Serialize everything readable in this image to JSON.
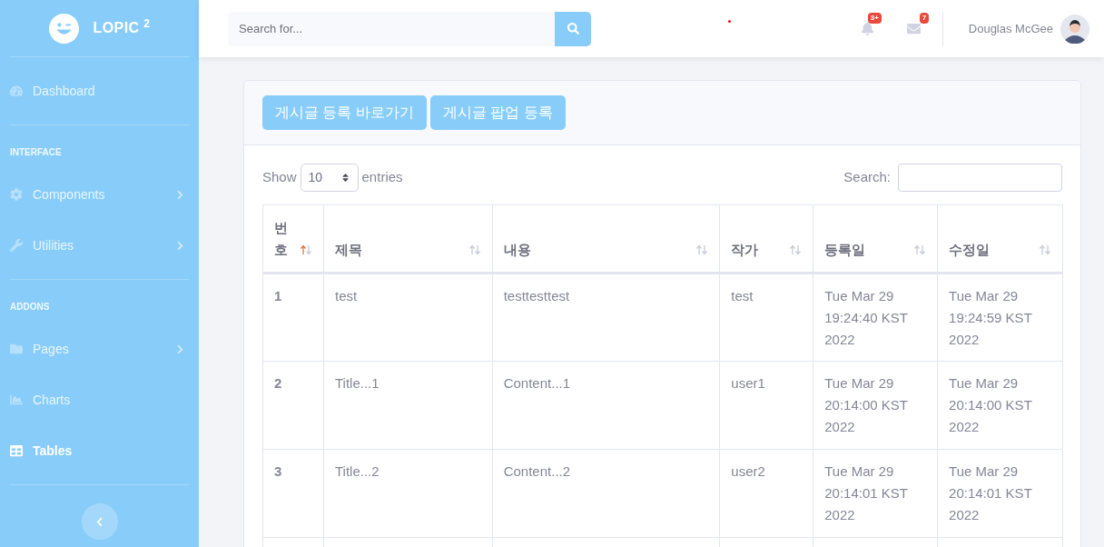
{
  "brand": {
    "name": "LOPIC",
    "sup": "2"
  },
  "sidebar": {
    "items": [
      {
        "kind": "link",
        "label": "Dashboard",
        "selected": false,
        "has_children": false
      },
      {
        "kind": "heading",
        "label": "INTERFACE"
      },
      {
        "kind": "link",
        "label": "Components",
        "selected": false,
        "has_children": true
      },
      {
        "kind": "link",
        "label": "Utilities",
        "selected": false,
        "has_children": true
      },
      {
        "kind": "heading",
        "label": "ADDONS"
      },
      {
        "kind": "link",
        "label": "Pages",
        "selected": false,
        "has_children": true
      },
      {
        "kind": "link",
        "label": "Charts",
        "selected": false,
        "has_children": false
      },
      {
        "kind": "link",
        "label": "Tables",
        "selected": true,
        "has_children": false
      }
    ]
  },
  "topbar": {
    "search": {
      "placeholder": "Search for..."
    },
    "alerts_badge": "3+",
    "messages_badge": "7",
    "user": "Douglas McGee"
  },
  "buttons": [
    "게시글 등록 바로가기",
    "게시글 팝업 등록"
  ],
  "table_controls": {
    "show": "Show",
    "page_size": "10",
    "entries": "entries",
    "search_label": "Search:"
  },
  "table": {
    "columns": [
      {
        "label": "번\n호",
        "sorted": true
      },
      {
        "label": "제목",
        "sorted": false
      },
      {
        "label": "내용",
        "sorted": false
      },
      {
        "label": "작가",
        "sorted": false
      },
      {
        "label": "등록일",
        "sorted": false
      },
      {
        "label": "수정일",
        "sorted": false
      }
    ],
    "rows": [
      [
        "1",
        "test",
        "testtesttest",
        "test",
        "Tue Mar 29 19:24:40 KST 2022",
        "Tue Mar 29 19:24:59 KST 2022"
      ],
      [
        "2",
        "Title...1",
        "Content...1",
        "user1",
        "Tue Mar 29 20:14:00 KST 2022",
        "Tue Mar 29 20:14:00 KST 2022"
      ],
      [
        "3",
        "Title...2",
        "Content...2",
        "user2",
        "Tue Mar 29 20:14:01 KST 2022",
        "Tue Mar 29 20:14:01 KST 2022"
      ]
    ]
  }
}
